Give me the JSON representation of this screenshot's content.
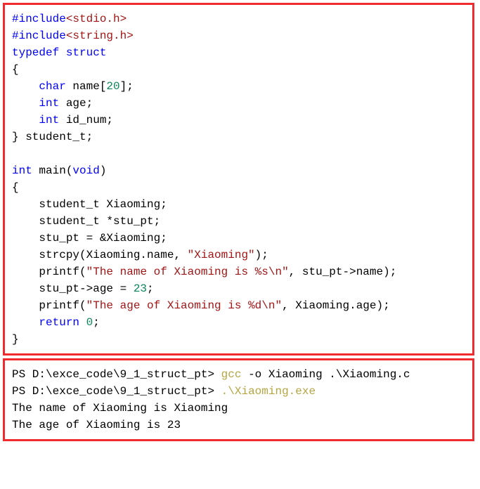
{
  "code": {
    "l1_a": "#include",
    "l1_b": "<stdio.h>",
    "l2_a": "#include",
    "l2_b": "<string.h>",
    "l3_a": "typedef",
    "l3_b": " ",
    "l3_c": "struct",
    "l4": "{",
    "l5_a": "    ",
    "l5_b": "char",
    "l5_c": " name[",
    "l5_d": "20",
    "l5_e": "];",
    "l6_a": "    ",
    "l6_b": "int",
    "l6_c": " age;",
    "l7_a": "    ",
    "l7_b": "int",
    "l7_c": " id_num;",
    "l8": "} student_t;",
    "l9": "",
    "l10_a": "int",
    "l10_b": " main(",
    "l10_c": "void",
    "l10_d": ")",
    "l11": "{",
    "l12": "    student_t Xiaoming;",
    "l13": "    student_t *stu_pt;",
    "l14": "    stu_pt = &Xiaoming;",
    "l15_a": "    strcpy(Xiaoming.name, ",
    "l15_b": "\"Xiaoming\"",
    "l15_c": ");",
    "l16_a": "    printf(",
    "l16_b": "\"The name of Xiaoming is %s\\n\"",
    "l16_c": ", stu_pt->name);",
    "l17_a": "    stu_pt->age = ",
    "l17_b": "23",
    "l17_c": ";",
    "l18_a": "    printf(",
    "l18_b": "\"The age of Xiaoming is %d\\n\"",
    "l18_c": ", Xiaoming.age);",
    "l19_a": "    ",
    "l19_b": "return",
    "l19_c": " ",
    "l19_d": "0",
    "l19_e": ";",
    "l20": "}"
  },
  "term": {
    "l1_a": "PS D:\\exce_code\\9_1_struct_pt> ",
    "l1_b": "gcc ",
    "l1_c": "-o Xiaoming .\\Xiaoming.c",
    "l2_a": "PS D:\\exce_code\\9_1_struct_pt> ",
    "l2_b": ".\\Xiaoming.exe",
    "l3": "The name of Xiaoming is Xiaoming",
    "l4": "The age of Xiaoming is 23"
  }
}
